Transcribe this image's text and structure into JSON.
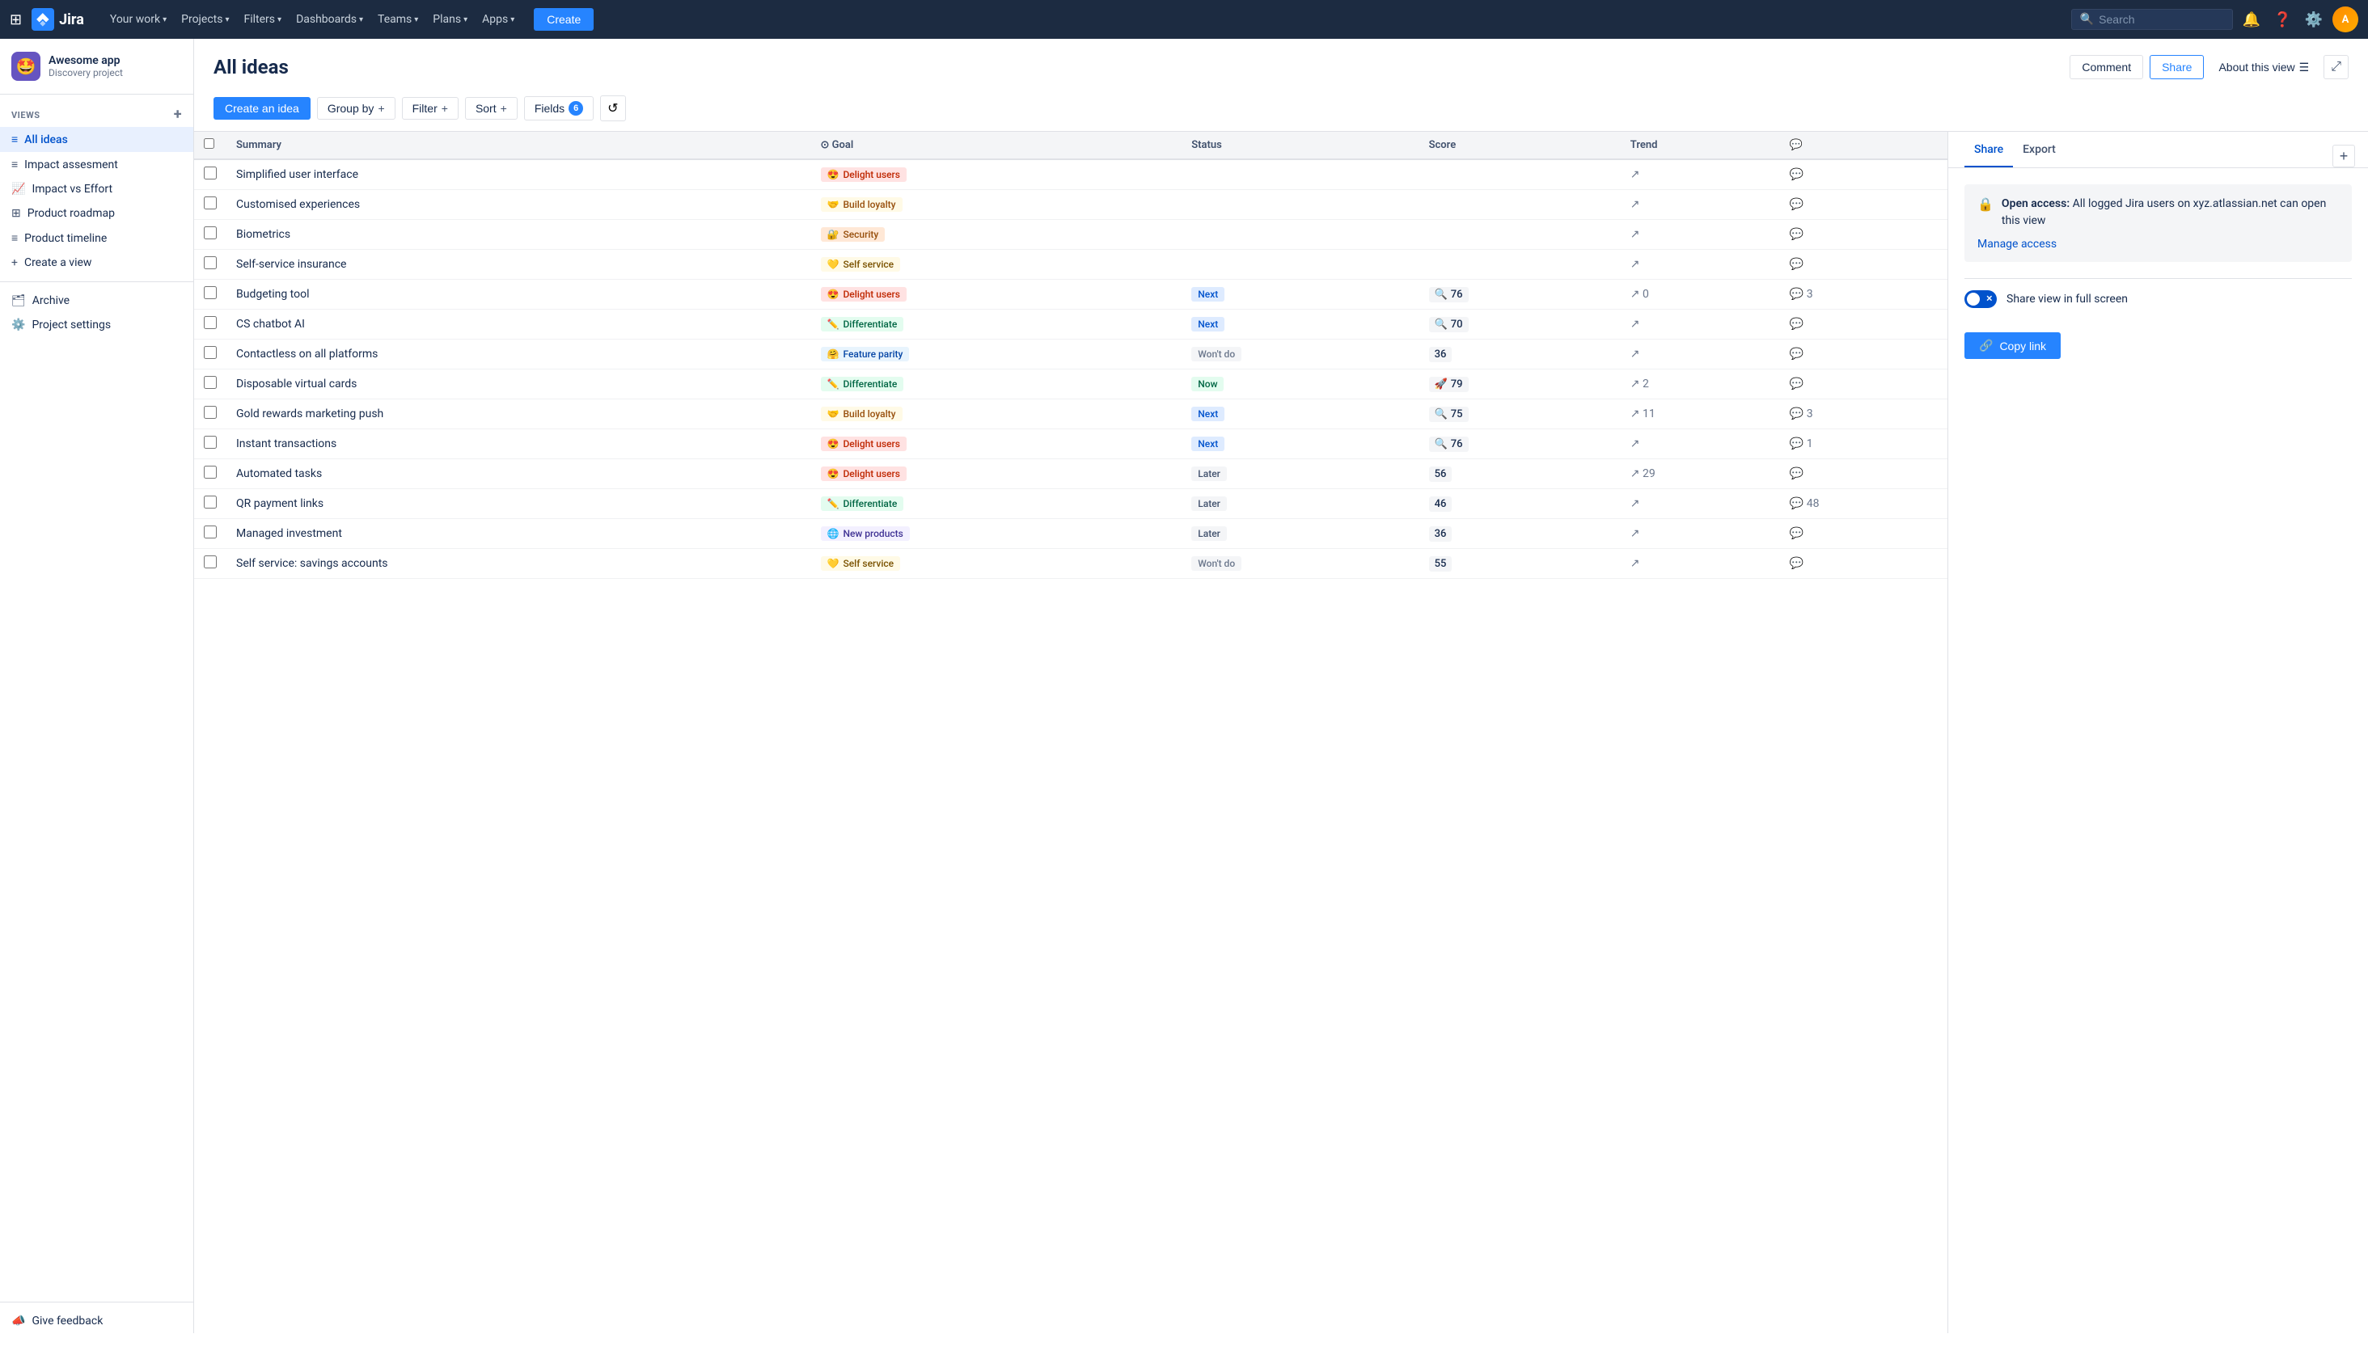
{
  "nav": {
    "logo_text": "Jira",
    "items": [
      {
        "label": "Your work",
        "chevron": "▾"
      },
      {
        "label": "Projects",
        "chevron": "▾"
      },
      {
        "label": "Filters",
        "chevron": "▾"
      },
      {
        "label": "Dashboards",
        "chevron": "▾"
      },
      {
        "label": "Teams",
        "chevron": "▾"
      },
      {
        "label": "Plans",
        "chevron": "▾"
      },
      {
        "label": "Apps",
        "chevron": "▾"
      }
    ],
    "create_label": "Create",
    "search_placeholder": "Search"
  },
  "sidebar": {
    "project_name": "Awesome app",
    "project_type": "Discovery project",
    "project_emoji": "🤩",
    "views_label": "VIEWS",
    "items": [
      {
        "label": "All ideas",
        "icon": "≡",
        "active": true
      },
      {
        "label": "Impact assesment",
        "icon": "≡",
        "active": false
      },
      {
        "label": "Impact vs Effort",
        "icon": "📈",
        "active": false
      },
      {
        "label": "Product roadmap",
        "icon": "⊞",
        "active": false
      },
      {
        "label": "Product timeline",
        "icon": "≡",
        "active": false
      },
      {
        "label": "Create a view",
        "icon": "+",
        "active": false
      }
    ],
    "archive_label": "Archive",
    "settings_label": "Project settings",
    "feedback_label": "Give feedback"
  },
  "page": {
    "title": "All ideas",
    "comment_btn": "Comment",
    "share_btn": "Share",
    "about_btn": "About this view",
    "expand_icon": "⤢"
  },
  "toolbar": {
    "create_btn": "Create an idea",
    "groupby_btn": "Group by",
    "filter_btn": "Filter",
    "sort_btn": "Sort",
    "fields_btn": "Fields",
    "fields_count": "6",
    "refresh_icon": "↺"
  },
  "table": {
    "columns": [
      "",
      "Summary",
      "Goal",
      "Status",
      "Score",
      "Trend",
      "Comments"
    ],
    "rows": [
      {
        "summary": "Simplified user interface",
        "goal": "Delight users",
        "goal_class": "delight",
        "goal_emoji": "😍",
        "status": "",
        "status_class": "",
        "score": "",
        "score_emoji": "",
        "trend": "",
        "trend_count": "",
        "comments": ""
      },
      {
        "summary": "Customised experiences",
        "goal": "Build loyalty",
        "goal_class": "loyalty",
        "goal_emoji": "🤝",
        "status": "",
        "status_class": "",
        "score": "",
        "score_emoji": "",
        "trend": "",
        "trend_count": "",
        "comments": ""
      },
      {
        "summary": "Biometrics",
        "goal": "Security",
        "goal_class": "security",
        "goal_emoji": "🔐",
        "status": "",
        "status_class": "",
        "score": "",
        "score_emoji": "",
        "trend": "",
        "trend_count": "",
        "comments": ""
      },
      {
        "summary": "Self-service insurance",
        "goal": "Self service",
        "goal_class": "selfservice",
        "goal_emoji": "💛",
        "status": "",
        "status_class": "",
        "score": "",
        "score_emoji": "",
        "trend": "",
        "trend_count": "",
        "comments": ""
      },
      {
        "summary": "Budgeting tool",
        "goal": "Delight users",
        "goal_class": "delight",
        "goal_emoji": "😍",
        "status": "Next",
        "status_class": "next",
        "score": "76",
        "score_emoji": "🔍",
        "trend": "↗",
        "trend_count": "0",
        "comments": "3"
      },
      {
        "summary": "CS chatbot AI",
        "goal": "Differentiate",
        "goal_class": "differentiate",
        "goal_emoji": "✏️",
        "status": "Next",
        "status_class": "next",
        "score": "70",
        "score_emoji": "🔍",
        "trend": "↗",
        "trend_count": "",
        "comments": ""
      },
      {
        "summary": "Contactless on all platforms",
        "goal": "Feature parity",
        "goal_class": "featureparity",
        "goal_emoji": "🤗",
        "status": "Won't do",
        "status_class": "wontdo",
        "score": "36",
        "score_emoji": "",
        "trend": "↗",
        "trend_count": "",
        "comments": ""
      },
      {
        "summary": "Disposable virtual cards",
        "goal": "Differentiate",
        "goal_class": "differentiate",
        "goal_emoji": "✏️",
        "status": "Now",
        "status_class": "now",
        "score": "79",
        "score_emoji": "🚀",
        "trend": "↗",
        "trend_count": "2",
        "comments": ""
      },
      {
        "summary": "Gold rewards marketing push",
        "goal": "Build loyalty",
        "goal_class": "loyalty",
        "goal_emoji": "🤝",
        "status": "Next",
        "status_class": "next",
        "score": "75",
        "score_emoji": "🔍",
        "trend": "↗",
        "trend_count": "11",
        "comments": "3"
      },
      {
        "summary": "Instant transactions",
        "goal": "Delight users",
        "goal_class": "delight",
        "goal_emoji": "😍",
        "status": "Next",
        "status_class": "next",
        "score": "76",
        "score_emoji": "🔍",
        "trend": "↗",
        "trend_count": "",
        "comments": "1"
      },
      {
        "summary": "Automated tasks",
        "goal": "Delight users",
        "goal_class": "delight",
        "goal_emoji": "😍",
        "status": "Later",
        "status_class": "later",
        "score": "56",
        "score_emoji": "",
        "trend": "↗",
        "trend_count": "29",
        "comments": ""
      },
      {
        "summary": "QR payment links",
        "goal": "Differentiate",
        "goal_class": "differentiate",
        "goal_emoji": "✏️",
        "status": "Later",
        "status_class": "later",
        "score": "46",
        "score_emoji": "",
        "trend": "↗",
        "trend_count": "",
        "comments": "48"
      },
      {
        "summary": "Managed investment",
        "goal": "New products",
        "goal_class": "newproducts",
        "goal_emoji": "🌐",
        "status": "Later",
        "status_class": "later",
        "score": "36",
        "score_emoji": "",
        "trend": "↗",
        "trend_count": "",
        "comments": ""
      },
      {
        "summary": "Self service: savings accounts",
        "goal": "Self service",
        "goal_class": "selfservice",
        "goal_emoji": "💛",
        "status": "Won't do",
        "status_class": "wontdo",
        "score": "55",
        "score_emoji": "",
        "trend": "↗",
        "trend_count": "",
        "comments": ""
      }
    ]
  },
  "share_panel": {
    "tab_share": "Share",
    "tab_export": "Export",
    "access_title": "Open access:",
    "access_desc": "All logged Jira users on xyz.atlassian.net can open this view",
    "manage_access": "Manage access",
    "toggle_label": "Share view in full screen",
    "copy_btn": "Copy link",
    "lock_icon": "🔒",
    "link_icon": "🔗"
  }
}
